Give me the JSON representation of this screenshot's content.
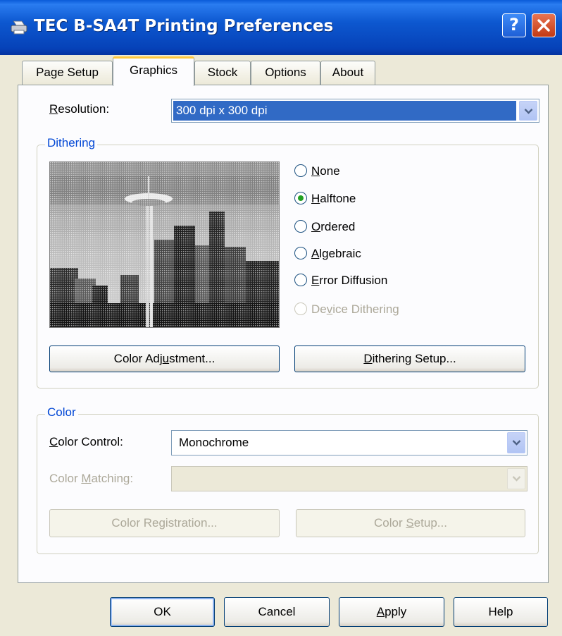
{
  "window": {
    "title": "TEC B-SA4T Printing Preferences",
    "help_glyph": "?",
    "close_glyph": "X"
  },
  "tabs": [
    "Page Setup",
    "Graphics",
    "Stock",
    "Options",
    "About"
  ],
  "active_tab": "Graphics",
  "resolution": {
    "label_accel": "R",
    "label_rest": "esolution:",
    "value": "300 dpi x 300 dpi"
  },
  "dithering": {
    "legend": "Dithering",
    "options": [
      {
        "accel": "N",
        "rest": "one",
        "checked": false,
        "disabled": false
      },
      {
        "accel": "H",
        "rest": "alftone",
        "checked": true,
        "disabled": false
      },
      {
        "accel": "O",
        "rest": "rdered",
        "checked": false,
        "disabled": false
      },
      {
        "accel": "A",
        "rest": "lgebraic",
        "checked": false,
        "disabled": false
      },
      {
        "accel": "E",
        "rest": "rror Diffusion",
        "checked": false,
        "disabled": false
      },
      {
        "pre": "De",
        "accel": "v",
        "rest": "ice Dithering",
        "checked": false,
        "disabled": true
      }
    ],
    "color_adjustment": {
      "pre": "Color Adj",
      "accel": "u",
      "rest": "stment..."
    },
    "dithering_setup": {
      "pre": "",
      "accel": "D",
      "rest": "ithering Setup..."
    }
  },
  "color": {
    "legend": "Color",
    "control": {
      "pre": "",
      "accel": "C",
      "rest": "olor Control:",
      "value": "Monochrome"
    },
    "matching": {
      "pre": "Color ",
      "accel": "M",
      "rest": "atching:",
      "value": ""
    },
    "registration": {
      "pre": "Color Re",
      "accel": "g",
      "rest": "istration..."
    },
    "setup": {
      "pre": "Color ",
      "accel": "S",
      "rest": "etup..."
    }
  },
  "footer": {
    "ok": "OK",
    "cancel": "Cancel",
    "apply": {
      "pre": "",
      "accel": "A",
      "rest": "pply"
    },
    "help": "Help"
  },
  "colors": {
    "title_blue": "#0a5bd8",
    "selection": "#316ac5",
    "group_legend": "#0046d5",
    "radio_dot": "#21a121",
    "disabled_text": "#aca899",
    "close_red": "#c23a14"
  }
}
